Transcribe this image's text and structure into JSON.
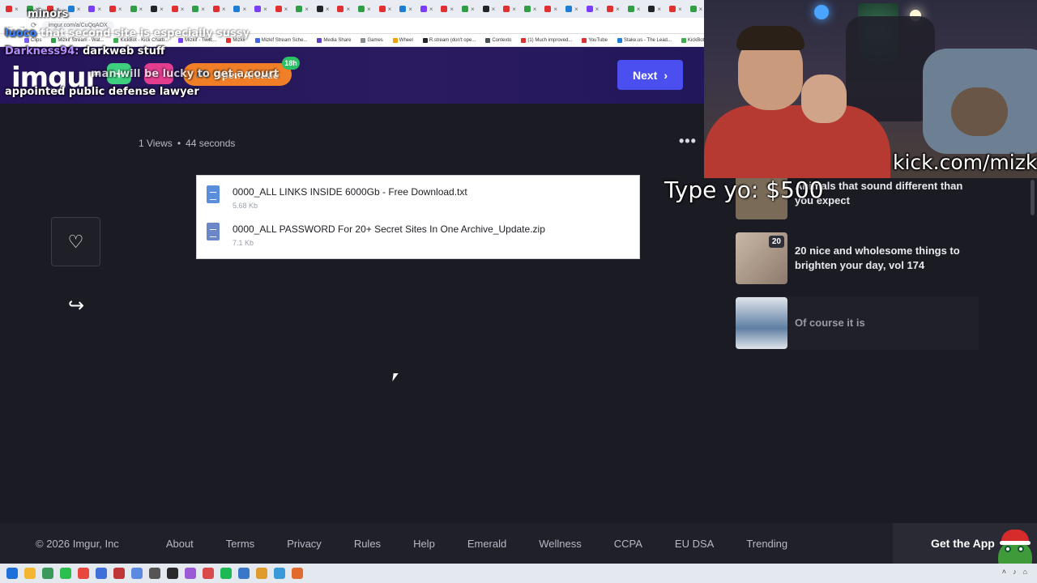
{
  "browser": {
    "url": "imgur.com/a/CuQqAOX",
    "tab_count": 34,
    "bookmarks": [
      {
        "label": "Clips",
        "color": "#7a5cff"
      },
      {
        "label": "Mizkif Stream - Wat...",
        "color": "#2f9e44"
      },
      {
        "label": "KickBot - Kick Chatb...",
        "color": "#3bb04a"
      },
      {
        "label": "Mizkif - Twitc...",
        "color": "#7a3cff"
      },
      {
        "label": "Mizkif",
        "color": "#e03131"
      },
      {
        "label": "Mizkif Stream Sche...",
        "color": "#4263eb"
      },
      {
        "label": "Media Share",
        "color": "#5f3dc4"
      },
      {
        "label": "Games",
        "color": "#868e96"
      },
      {
        "label": "Wheel",
        "color": "#f59f00"
      },
      {
        "label": "R.stream (don't ope...",
        "color": "#212529"
      },
      {
        "label": "Contexto",
        "color": "#495057"
      },
      {
        "label": "(1) Much improved...",
        "color": "#e03131"
      },
      {
        "label": "YouTube",
        "color": "#e03131"
      },
      {
        "label": "Stake.us - The Lead...",
        "color": "#1c7ed6"
      },
      {
        "label": "KickBot Ot",
        "color": "#3bb04a"
      }
    ]
  },
  "imgur": {
    "logo": "imgur",
    "badge": "18h",
    "upload_label": "Open Arcade",
    "next_label": "Next",
    "views": "1 Views",
    "separator": "•",
    "age": "44 seconds",
    "files": [
      {
        "name": "0000_ALL LINKS INSIDE 6000Gb - Free Download.txt",
        "size": "5.68 Kb",
        "type": "doc"
      },
      {
        "name": "0000_ALL PASSWORD For 20+ Secret Sites In One Archive_Update.zip",
        "size": "7.1 Kb",
        "type": "zip"
      }
    ],
    "rail": [
      {
        "title": "Animals that sound different than you expect",
        "thumb_color": "#7a6a58",
        "count": ""
      },
      {
        "title": "20 nice and wholesome things to brighten your day, vol 174",
        "thumb_color": "#b8a79a",
        "count": "20"
      },
      {
        "title": "Of course it is",
        "thumb_color": "#5e7fa3",
        "count": ""
      }
    ],
    "footer": {
      "copyright": "© 2026 Imgur, Inc",
      "links": [
        "About",
        "Terms",
        "Privacy",
        "Rules",
        "Help",
        "Emerald",
        "Wellness",
        "CCPA",
        "EU DSA",
        "Trending"
      ],
      "get_app": "Get the App"
    }
  },
  "overlay": {
    "chat": [
      {
        "user": "",
        "text": "minors"
      },
      {
        "user": "luoco",
        "text": "that second site is especially sussy"
      },
      {
        "user": "Darkness94:",
        "text": "darkweb stuff"
      },
      {
        "user": "",
        "text": "man will be lucky to get a court"
      },
      {
        "user": "",
        "text": "appointed public defense lawyer"
      }
    ],
    "kick_url": "kick.com/mizkif",
    "donation": "Type yo: $500"
  },
  "taskbar": {
    "icons": [
      {
        "name": "windows",
        "color": "#1e6fd9"
      },
      {
        "name": "files",
        "color": "#f2b632"
      },
      {
        "name": "app1",
        "color": "#3a9a5b"
      },
      {
        "name": "app2",
        "color": "#2cbf4f"
      },
      {
        "name": "chrome",
        "color": "#e7473c"
      },
      {
        "name": "app3",
        "color": "#3f6fd8"
      },
      {
        "name": "app4",
        "color": "#c03535"
      },
      {
        "name": "app5",
        "color": "#5b8be0"
      },
      {
        "name": "app6",
        "color": "#555"
      },
      {
        "name": "app7",
        "color": "#2a2a2a"
      },
      {
        "name": "app8",
        "color": "#9b59d6"
      },
      {
        "name": "app9",
        "color": "#d94b4b"
      },
      {
        "name": "spotify",
        "color": "#1db954"
      },
      {
        "name": "app10",
        "color": "#3b77c9"
      },
      {
        "name": "app11",
        "color": "#e09b2d"
      },
      {
        "name": "app12",
        "color": "#3a9ad9"
      },
      {
        "name": "app13",
        "color": "#e06b2d"
      }
    ]
  }
}
